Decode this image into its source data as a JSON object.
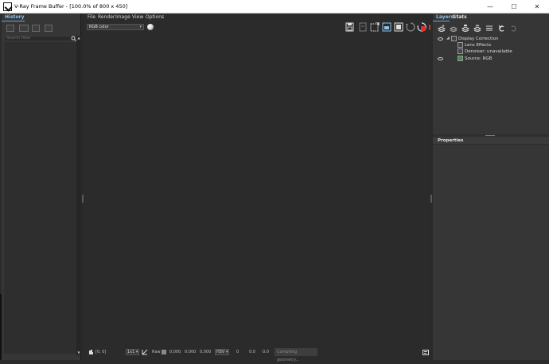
{
  "window": {
    "title": "V-Ray Frame Buffer - [100.0% of 800 x 450]",
    "minimize": "—",
    "maximize": "☐",
    "close": "✕"
  },
  "history": {
    "tab_label": "History",
    "search_placeholder": "Search filter"
  },
  "menubar": {
    "items": [
      "File",
      "Render",
      "Image",
      "View",
      "Options"
    ]
  },
  "toolbar": {
    "channel": "RGB color"
  },
  "statusbar": {
    "coords": "[0, 0]",
    "zoom_mode": "1x1",
    "raw_label": "Raw",
    "raw_r": "0.000",
    "raw_g": "0.000",
    "raw_b": "0.000",
    "color_mode": "HSV",
    "h": "0",
    "s": "0.0",
    "v": "0.0",
    "progress_text": "Compiling geometry..."
  },
  "layers_panel": {
    "tab_layers": "Layers",
    "tab_stats": "Stats",
    "tree": {
      "display_correction": "Display Correction",
      "lens_effects": "Lens Effects",
      "denoiser": "Denoiser: unavailable",
      "source": "Source: RGB"
    }
  },
  "properties": {
    "header": "Properties"
  },
  "colors": {
    "accent": "#8fc3ea",
    "panel": "#363636",
    "viewport": "#2b2b2b"
  }
}
